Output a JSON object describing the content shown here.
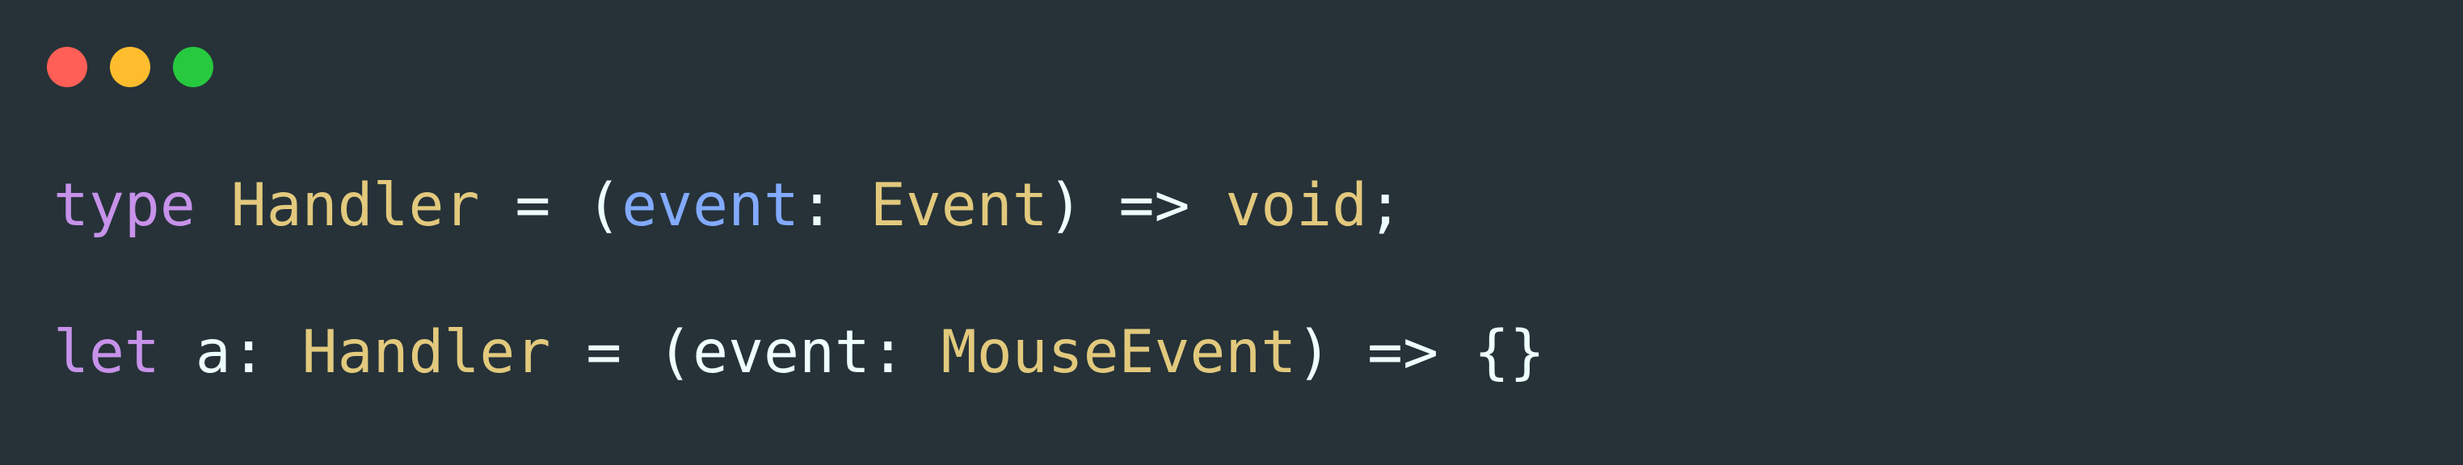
{
  "window": {
    "colors": {
      "background": "#263238",
      "close": "#ff5f56",
      "minimize": "#ffbd2e",
      "zoom": "#27c93f",
      "keyword": "#c792ea",
      "type": "#e2c97d",
      "param": "#82aaff",
      "plain": "#eeffff"
    }
  },
  "code": {
    "line1": [
      {
        "text": "type",
        "role": "keyword"
      },
      {
        "text": " ",
        "role": "plain"
      },
      {
        "text": "Handler",
        "role": "type"
      },
      {
        "text": " = (",
        "role": "plain"
      },
      {
        "text": "event",
        "role": "param"
      },
      {
        "text": ": ",
        "role": "plain"
      },
      {
        "text": "Event",
        "role": "type"
      },
      {
        "text": ") => ",
        "role": "plain"
      },
      {
        "text": "void",
        "role": "type"
      },
      {
        "text": ";",
        "role": "plain"
      }
    ],
    "line2": [
      {
        "text": "let",
        "role": "keyword"
      },
      {
        "text": " a: ",
        "role": "plain"
      },
      {
        "text": "Handler",
        "role": "type"
      },
      {
        "text": " = (event: ",
        "role": "plain"
      },
      {
        "text": "MouseEvent",
        "role": "type"
      },
      {
        "text": ") => {}",
        "role": "plain"
      }
    ]
  }
}
